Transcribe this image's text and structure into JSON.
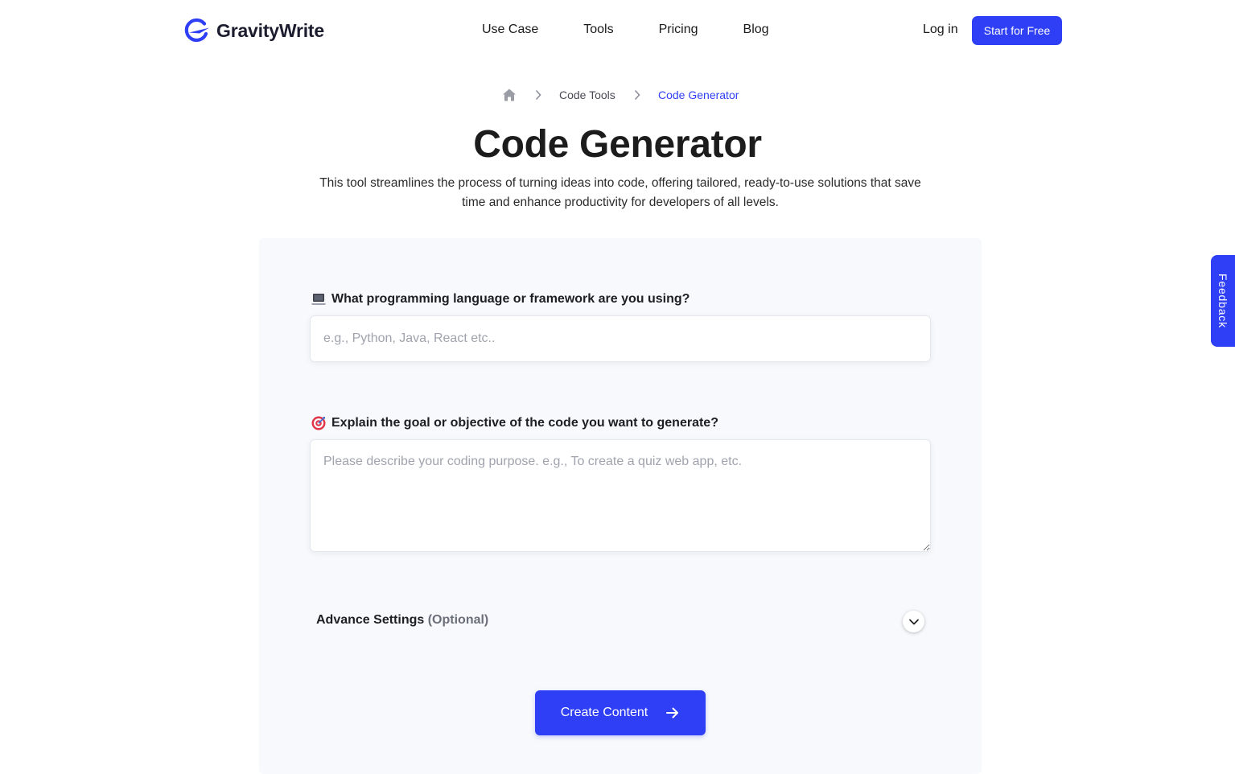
{
  "header": {
    "brand": "GravityWrite",
    "nav": [
      "Use Case",
      "Tools",
      "Pricing",
      "Blog"
    ],
    "login_label": "Log in",
    "cta_label": "Start for Free"
  },
  "breadcrumb": {
    "home_icon": "home-icon",
    "parent": "Code Tools",
    "current": "Code Generator"
  },
  "page": {
    "title": "Code Generator",
    "description": "This tool streamlines the process of turning ideas into code, offering tailored, ready-to-use solutions that save time and enhance productivity for developers of all levels."
  },
  "form": {
    "language": {
      "label": "What programming language or framework are you using?",
      "icon": "laptop-icon",
      "placeholder": "e.g., Python, Java, React etc..",
      "value": ""
    },
    "goal": {
      "label": "Explain the goal or objective of the code you want to generate?",
      "icon": "target-icon",
      "placeholder": "Please describe your coding purpose. e.g., To create a quiz web app, etc.",
      "value": ""
    },
    "advanced": {
      "label": "Advance Settings",
      "optional": "(Optional)"
    },
    "submit_label": "Create Content"
  },
  "feedback_label": "Feedback",
  "colors": {
    "accent": "#2f3ff5",
    "panel_bg": "#f7f9fc",
    "text": "#1a1a1a"
  }
}
